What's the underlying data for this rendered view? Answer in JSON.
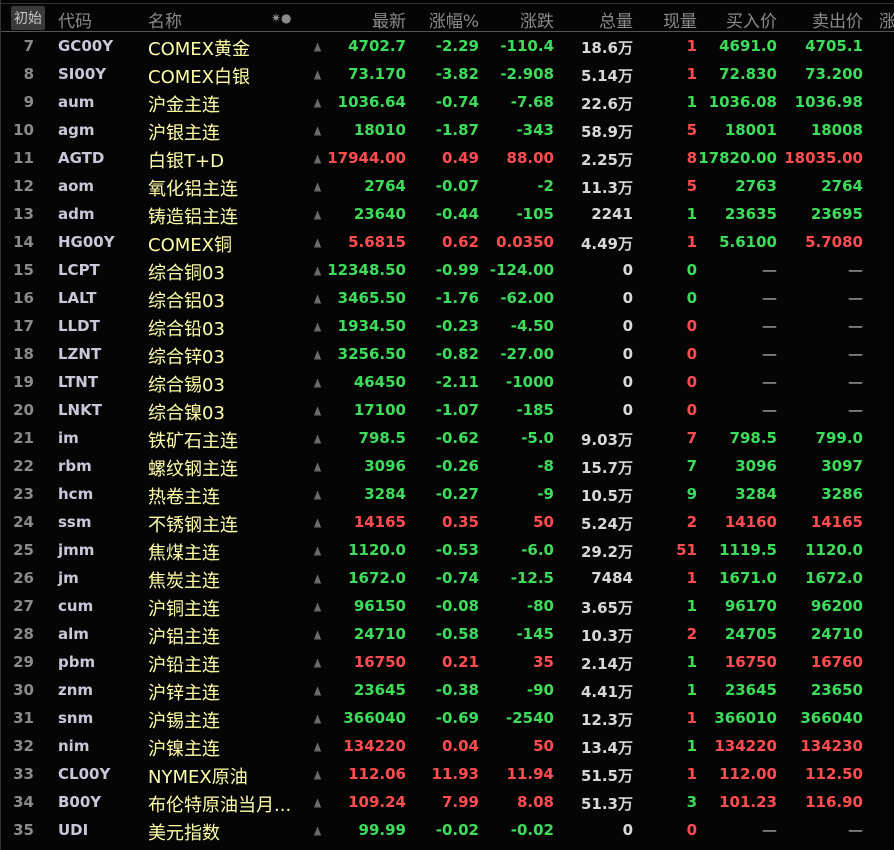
{
  "header": {
    "init": "初始",
    "code": "代码",
    "name": "名称",
    "icons": "✷●",
    "last": "最新",
    "pct": "涨幅%",
    "chg": "涨跌",
    "vol": "总量",
    "cur": "现量",
    "bid": "买入价",
    "ask": "卖出价",
    "more": "涨"
  },
  "colors": {
    "up": "#ff4d4f",
    "down": "#3ddc5a"
  },
  "rows": [
    [
      "7",
      "GC00Y",
      "COMEX黄金",
      "4702.7",
      "-2.29",
      "-110.4",
      "18.6万",
      "1",
      "4691.0",
      "4705.1",
      "d",
      "u",
      "d",
      "d"
    ],
    [
      "8",
      "SI00Y",
      "COMEX白银",
      "73.170",
      "-3.82",
      "-2.908",
      "5.14万",
      "1",
      "72.830",
      "73.200",
      "d",
      "u",
      "d",
      "d"
    ],
    [
      "9",
      "aum",
      "沪金主连",
      "1036.64",
      "-0.74",
      "-7.68",
      "22.6万",
      "1",
      "1036.08",
      "1036.98",
      "d",
      "d",
      "d",
      "d"
    ],
    [
      "10",
      "agm",
      "沪银主连",
      "18010",
      "-1.87",
      "-343",
      "58.9万",
      "5",
      "18001",
      "18008",
      "d",
      "u",
      "d",
      "d"
    ],
    [
      "11",
      "AGTD",
      "白银T+D",
      "17944.00",
      "0.49",
      "88.00",
      "2.25万",
      "8",
      "17820.00",
      "18035.00",
      "u",
      "u",
      "d",
      "u"
    ],
    [
      "12",
      "aom",
      "氧化铝主连",
      "2764",
      "-0.07",
      "-2",
      "11.3万",
      "5",
      "2763",
      "2764",
      "d",
      "u",
      "d",
      "d"
    ],
    [
      "13",
      "adm",
      "铸造铝主连",
      "23640",
      "-0.44",
      "-105",
      "2241",
      "1",
      "23635",
      "23695",
      "d",
      "d",
      "d",
      "d"
    ],
    [
      "14",
      "HG00Y",
      "COMEX铜",
      "5.6815",
      "0.62",
      "0.0350",
      "4.49万",
      "1",
      "5.6100",
      "5.7080",
      "u",
      "u",
      "d",
      "u"
    ],
    [
      "15",
      "LCPT",
      "综合铜03",
      "12348.50",
      "-0.99",
      "-124.00",
      "0",
      "0",
      "—",
      "—",
      "d",
      "d",
      "w",
      "w"
    ],
    [
      "16",
      "LALT",
      "综合铝03",
      "3465.50",
      "-1.76",
      "-62.00",
      "0",
      "0",
      "—",
      "—",
      "d",
      "d",
      "w",
      "w"
    ],
    [
      "17",
      "LLDT",
      "综合铅03",
      "1934.50",
      "-0.23",
      "-4.50",
      "0",
      "0",
      "—",
      "—",
      "d",
      "u",
      "w",
      "w"
    ],
    [
      "18",
      "LZNT",
      "综合锌03",
      "3256.50",
      "-0.82",
      "-27.00",
      "0",
      "0",
      "—",
      "—",
      "d",
      "u",
      "w",
      "w"
    ],
    [
      "19",
      "LTNT",
      "综合锡03",
      "46450",
      "-2.11",
      "-1000",
      "0",
      "0",
      "—",
      "—",
      "d",
      "u",
      "w",
      "w"
    ],
    [
      "20",
      "LNKT",
      "综合镍03",
      "17100",
      "-1.07",
      "-185",
      "0",
      "0",
      "—",
      "—",
      "d",
      "u",
      "w",
      "w"
    ],
    [
      "21",
      "im",
      "铁矿石主连",
      "798.5",
      "-0.62",
      "-5.0",
      "9.03万",
      "7",
      "798.5",
      "799.0",
      "d",
      "u",
      "d",
      "d"
    ],
    [
      "22",
      "rbm",
      "螺纹钢主连",
      "3096",
      "-0.26",
      "-8",
      "15.7万",
      "7",
      "3096",
      "3097",
      "d",
      "d",
      "d",
      "d"
    ],
    [
      "23",
      "hcm",
      "热卷主连",
      "3284",
      "-0.27",
      "-9",
      "10.5万",
      "9",
      "3284",
      "3286",
      "d",
      "d",
      "d",
      "d"
    ],
    [
      "24",
      "ssm",
      "不锈钢主连",
      "14165",
      "0.35",
      "50",
      "5.24万",
      "2",
      "14160",
      "14165",
      "u",
      "u",
      "u",
      "u"
    ],
    [
      "25",
      "jmm",
      "焦煤主连",
      "1120.0",
      "-0.53",
      "-6.0",
      "29.2万",
      "51",
      "1119.5",
      "1120.0",
      "d",
      "u",
      "d",
      "d"
    ],
    [
      "26",
      "jm",
      "焦炭主连",
      "1672.0",
      "-0.74",
      "-12.5",
      "7484",
      "1",
      "1671.0",
      "1672.0",
      "d",
      "u",
      "d",
      "d"
    ],
    [
      "27",
      "cum",
      "沪铜主连",
      "96150",
      "-0.08",
      "-80",
      "3.65万",
      "1",
      "96170",
      "96200",
      "d",
      "d",
      "d",
      "d"
    ],
    [
      "28",
      "alm",
      "沪铝主连",
      "24710",
      "-0.58",
      "-145",
      "10.3万",
      "2",
      "24705",
      "24710",
      "d",
      "u",
      "d",
      "d"
    ],
    [
      "29",
      "pbm",
      "沪铅主连",
      "16750",
      "0.21",
      "35",
      "2.14万",
      "1",
      "16750",
      "16760",
      "u",
      "d",
      "u",
      "u"
    ],
    [
      "30",
      "znm",
      "沪锌主连",
      "23645",
      "-0.38",
      "-90",
      "4.41万",
      "1",
      "23645",
      "23650",
      "d",
      "d",
      "d",
      "d"
    ],
    [
      "31",
      "snm",
      "沪锡主连",
      "366040",
      "-0.69",
      "-2540",
      "12.3万",
      "1",
      "366010",
      "366040",
      "d",
      "u",
      "d",
      "d"
    ],
    [
      "32",
      "nim",
      "沪镍主连",
      "134220",
      "0.04",
      "50",
      "13.4万",
      "1",
      "134220",
      "134230",
      "u",
      "d",
      "u",
      "u"
    ],
    [
      "33",
      "CL00Y",
      "NYMEX原油",
      "112.06",
      "11.93",
      "11.94",
      "51.5万",
      "1",
      "112.00",
      "112.50",
      "u",
      "u",
      "u",
      "u"
    ],
    [
      "34",
      "B00Y",
      "布伦特原油当月...",
      "109.24",
      "7.99",
      "8.08",
      "51.3万",
      "3",
      "101.23",
      "116.90",
      "u",
      "d",
      "u",
      "u"
    ],
    [
      "35",
      "UDI",
      "美元指数",
      "99.99",
      "-0.02",
      "-0.02",
      "0",
      "0",
      "—",
      "—",
      "d",
      "u",
      "w",
      "w"
    ]
  ]
}
